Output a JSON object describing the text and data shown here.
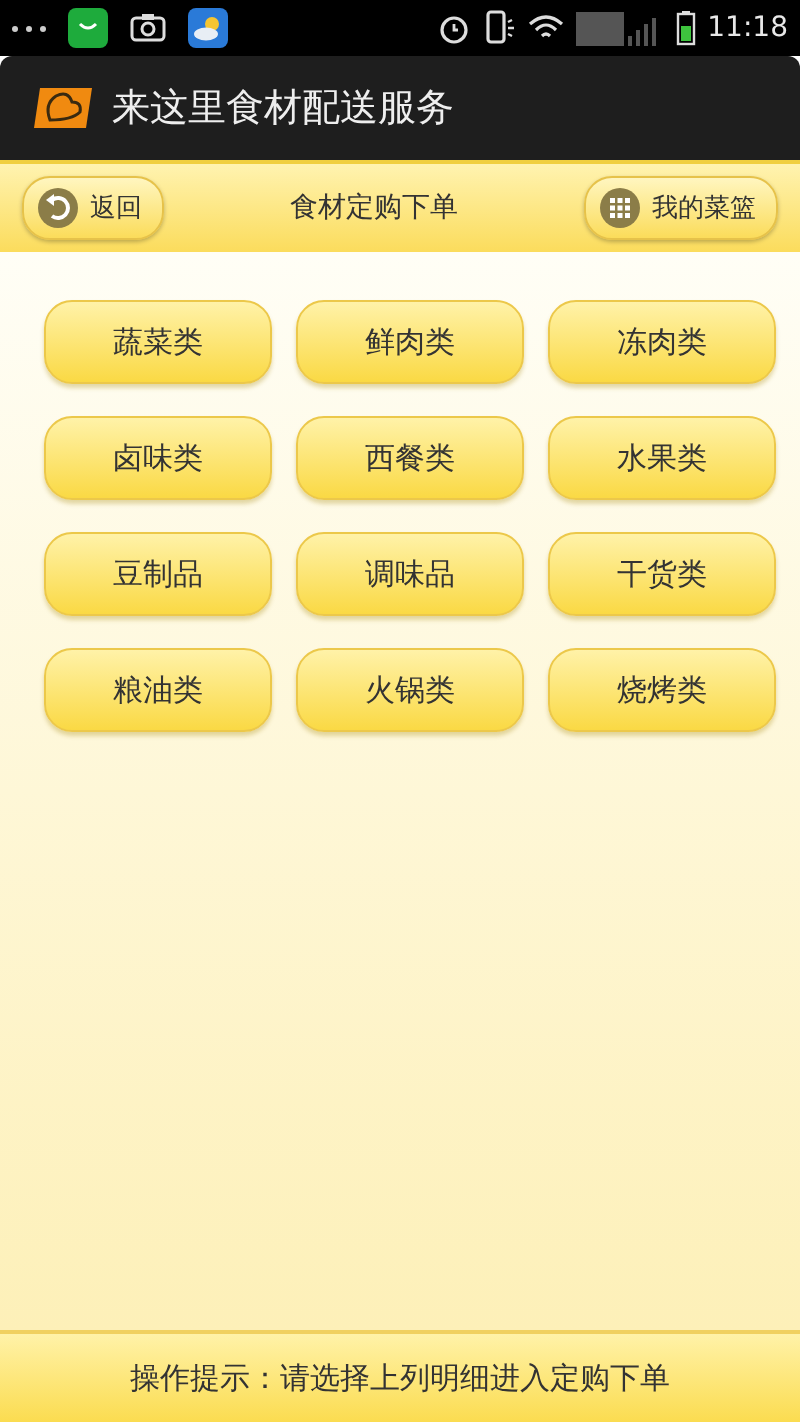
{
  "status_bar": {
    "time": "11:18"
  },
  "app_bar": {
    "title": "来这里食材配送服务"
  },
  "nav_bar": {
    "back": "返回",
    "title": "食材定购下单",
    "basket": "我的菜篮"
  },
  "categories": [
    {
      "label": "蔬菜类"
    },
    {
      "label": "鲜肉类"
    },
    {
      "label": "冻肉类"
    },
    {
      "label": "卤味类"
    },
    {
      "label": "西餐类"
    },
    {
      "label": "水果类"
    },
    {
      "label": "豆制品"
    },
    {
      "label": "调味品"
    },
    {
      "label": "干货类"
    },
    {
      "label": "粮油类"
    },
    {
      "label": "火锅类"
    },
    {
      "label": "烧烤类"
    }
  ],
  "footer": {
    "hint": "操作提示：请选择上列明细进入定购下单"
  }
}
